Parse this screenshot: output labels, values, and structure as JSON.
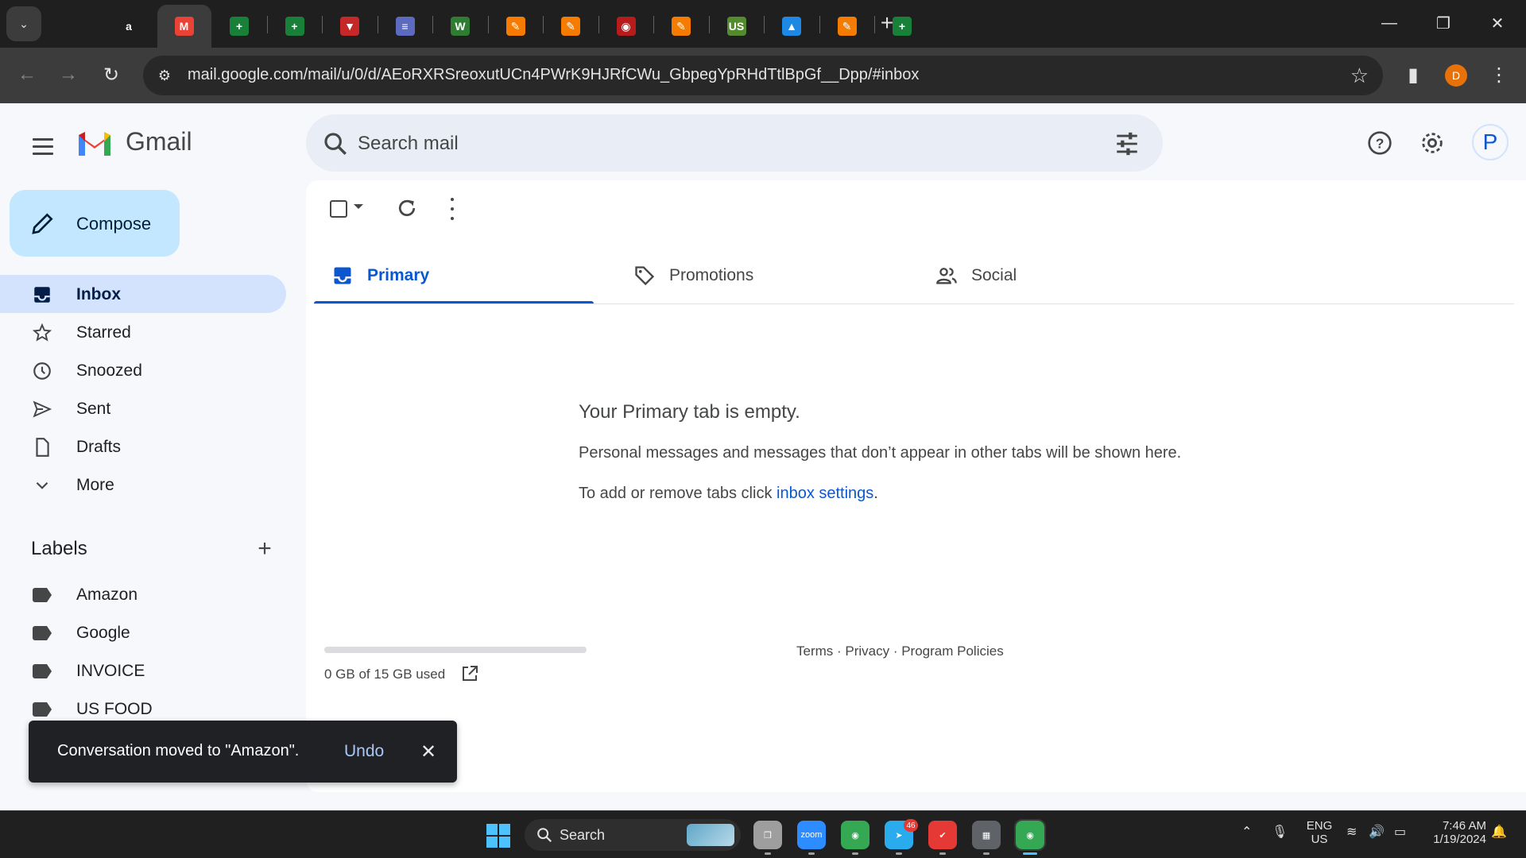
{
  "browser": {
    "url": "mail.google.com/mail/u/0/d/AEoRXRSreoxutUCn4PWrK9HJRfCWu_GbpegYpRHdTtlBpGf__Dpp/#inbox",
    "profile_initial": "D",
    "tabs": [
      {
        "icon": "amazon-icon",
        "glyph": "a",
        "color": "#1f1f1f"
      },
      {
        "icon": "gmail-icon",
        "glyph": "M",
        "color": "#ea4335",
        "active": true
      },
      {
        "icon": "sheets-icon",
        "glyph": "+",
        "color": "#188038"
      },
      {
        "icon": "sheets-icon",
        "glyph": "+",
        "color": "#188038"
      },
      {
        "icon": "red-chevron-icon",
        "glyph": "▼",
        "color": "#c62828"
      },
      {
        "icon": "flag-icon",
        "glyph": "≡",
        "color": "#5c6bc0"
      },
      {
        "icon": "w-icon",
        "glyph": "W",
        "color": "#2e7d32"
      },
      {
        "icon": "pen-icon",
        "glyph": "✎",
        "color": "#f57c00"
      },
      {
        "icon": "pen-icon",
        "glyph": "✎",
        "color": "#f57c00"
      },
      {
        "icon": "awl-icon",
        "glyph": "◉",
        "color": "#b71c1c"
      },
      {
        "icon": "pen-icon",
        "glyph": "✎",
        "color": "#f57c00"
      },
      {
        "icon": "usfoods-icon",
        "glyph": "US",
        "color": "#558b2f"
      },
      {
        "icon": "drive-icon",
        "glyph": "▲",
        "color": "#1e88e5"
      },
      {
        "icon": "pen-icon",
        "glyph": "✎",
        "color": "#f57c00"
      },
      {
        "icon": "sheets-icon",
        "glyph": "+",
        "color": "#188038"
      }
    ]
  },
  "gmail": {
    "product_name": "Gmail",
    "search_placeholder": "Search mail",
    "account_initial": "P",
    "compose_label": "Compose",
    "nav": [
      {
        "label": "Inbox",
        "icon": "inbox-icon",
        "active": true
      },
      {
        "label": "Starred",
        "icon": "star-icon"
      },
      {
        "label": "Snoozed",
        "icon": "clock-icon"
      },
      {
        "label": "Sent",
        "icon": "send-icon"
      },
      {
        "label": "Drafts",
        "icon": "draft-icon"
      },
      {
        "label": "More",
        "icon": "chevron-down-icon"
      }
    ],
    "labels_heading": "Labels",
    "labels": [
      "Amazon",
      "Google",
      "INVOICE",
      "US FOOD"
    ],
    "category_tabs": [
      {
        "label": "Primary",
        "icon": "inbox-icon",
        "active": true
      },
      {
        "label": "Promotions",
        "icon": "tag-icon"
      },
      {
        "label": "Social",
        "icon": "people-icon"
      }
    ],
    "empty": {
      "title": "Your Primary tab is empty.",
      "description": "Personal messages and messages that don’t appear in other tabs will be shown here.",
      "hint_prefix": "To add or remove tabs click ",
      "hint_link": "inbox settings",
      "hint_suffix": "."
    },
    "storage": {
      "text": "0 GB of 15 GB used",
      "used_fraction": 0
    },
    "footer": "Terms · Privacy · Program Policies",
    "snackbar": {
      "message": "Conversation moved to \"Amazon\".",
      "action": "Undo"
    }
  },
  "taskbar": {
    "search_label": "Search",
    "apps": [
      {
        "name": "task-view-icon",
        "color": "#9e9e9e",
        "glyph": "❐"
      },
      {
        "name": "zoom-icon",
        "color": "#2d8cff",
        "glyph": "zoom"
      },
      {
        "name": "chrome-icon",
        "color": "#34a853",
        "glyph": "◉"
      },
      {
        "name": "telegram-icon",
        "color": "#2aabee",
        "glyph": "➤",
        "badge": "46"
      },
      {
        "name": "check-app-icon",
        "color": "#e53935",
        "glyph": "✔"
      },
      {
        "name": "calculator-icon",
        "color": "#5f6368",
        "glyph": "▦"
      },
      {
        "name": "chrome-profile-icon",
        "color": "#34a853",
        "glyph": "◉",
        "active": true
      }
    ],
    "language": "ENG",
    "region": "US",
    "time": "7:46 AM",
    "date": "1/19/2024"
  }
}
